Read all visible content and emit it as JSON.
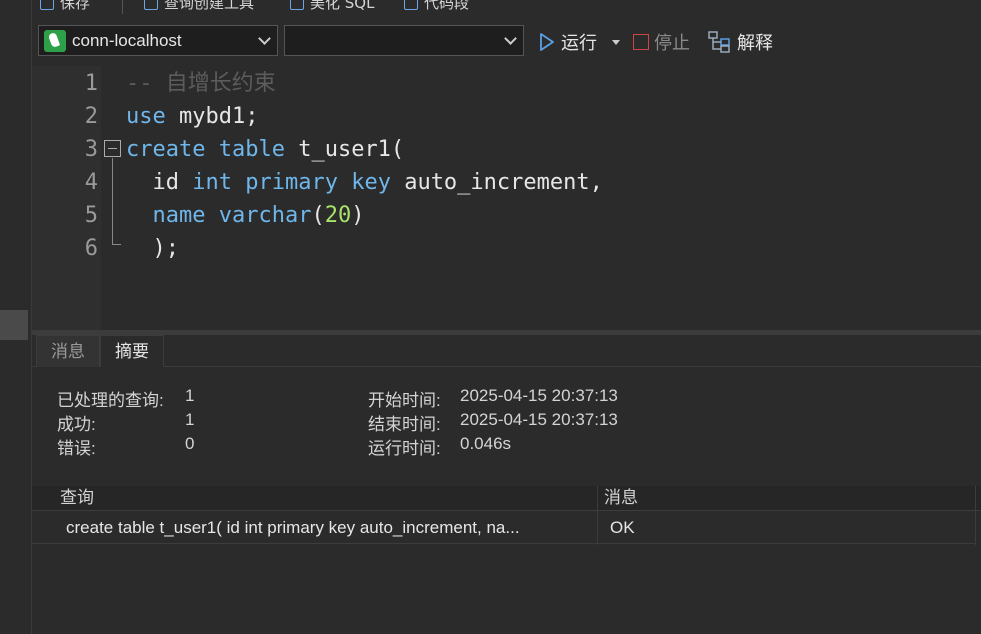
{
  "toolbar_top": {
    "save_label": "保存",
    "query_builder_label": "查询创建工具",
    "beautify_label": "美化 SQL",
    "snippet_label": "代码段"
  },
  "toolbar": {
    "connection": "conn-localhost",
    "database": "",
    "run_label": "运行",
    "stop_label": "停止",
    "explain_label": "解释"
  },
  "editor": {
    "lines": [
      {
        "num": "1",
        "tokens": [
          {
            "t": "-- 自增长约束",
            "c": "c-com"
          }
        ]
      },
      {
        "num": "2",
        "tokens": [
          {
            "t": "use",
            "c": "c-kw"
          },
          {
            "t": " mybd1;",
            "c": "c-id"
          }
        ]
      },
      {
        "num": "3",
        "tokens": [
          {
            "t": "create",
            "c": "c-kw"
          },
          {
            "t": " ",
            "c": "c-id"
          },
          {
            "t": "table",
            "c": "c-kw"
          },
          {
            "t": " t_user1(",
            "c": "c-id"
          }
        ]
      },
      {
        "num": "4",
        "tokens": [
          {
            "t": "  id ",
            "c": "c-id"
          },
          {
            "t": "int",
            "c": "c-kw"
          },
          {
            "t": " ",
            "c": "c-id"
          },
          {
            "t": "primary",
            "c": "c-kw"
          },
          {
            "t": " ",
            "c": "c-id"
          },
          {
            "t": "key",
            "c": "c-kw"
          },
          {
            "t": " auto_increment,",
            "c": "c-id"
          }
        ]
      },
      {
        "num": "5",
        "tokens": [
          {
            "t": "  ",
            "c": "c-id"
          },
          {
            "t": "name",
            "c": "c-kw"
          },
          {
            "t": " ",
            "c": "c-id"
          },
          {
            "t": "varchar",
            "c": "c-kw"
          },
          {
            "t": "(",
            "c": "c-id"
          },
          {
            "t": "20",
            "c": "c-num"
          },
          {
            "t": ")",
            "c": "c-id"
          }
        ]
      },
      {
        "num": "6",
        "tokens": [
          {
            "t": "  );",
            "c": "c-id"
          }
        ]
      }
    ]
  },
  "result_tabs": {
    "messages": "消息",
    "summary": "摘要"
  },
  "summary": {
    "processed_label": "已处理的查询:",
    "processed_value": "1",
    "success_label": "成功:",
    "success_value": "1",
    "error_label": "错误:",
    "error_value": "0",
    "start_label": "开始时间:",
    "start_value": "2025-04-15 20:37:13",
    "end_label": "结束时间:",
    "end_value": "2025-04-15 20:37:13",
    "elapsed_label": "运行时间:",
    "elapsed_value": "0.046s"
  },
  "grid": {
    "headers": [
      "查询",
      "消息"
    ],
    "rows": [
      [
        "create table t_user1( id int primary key auto_increment, na...",
        "OK"
      ]
    ]
  }
}
